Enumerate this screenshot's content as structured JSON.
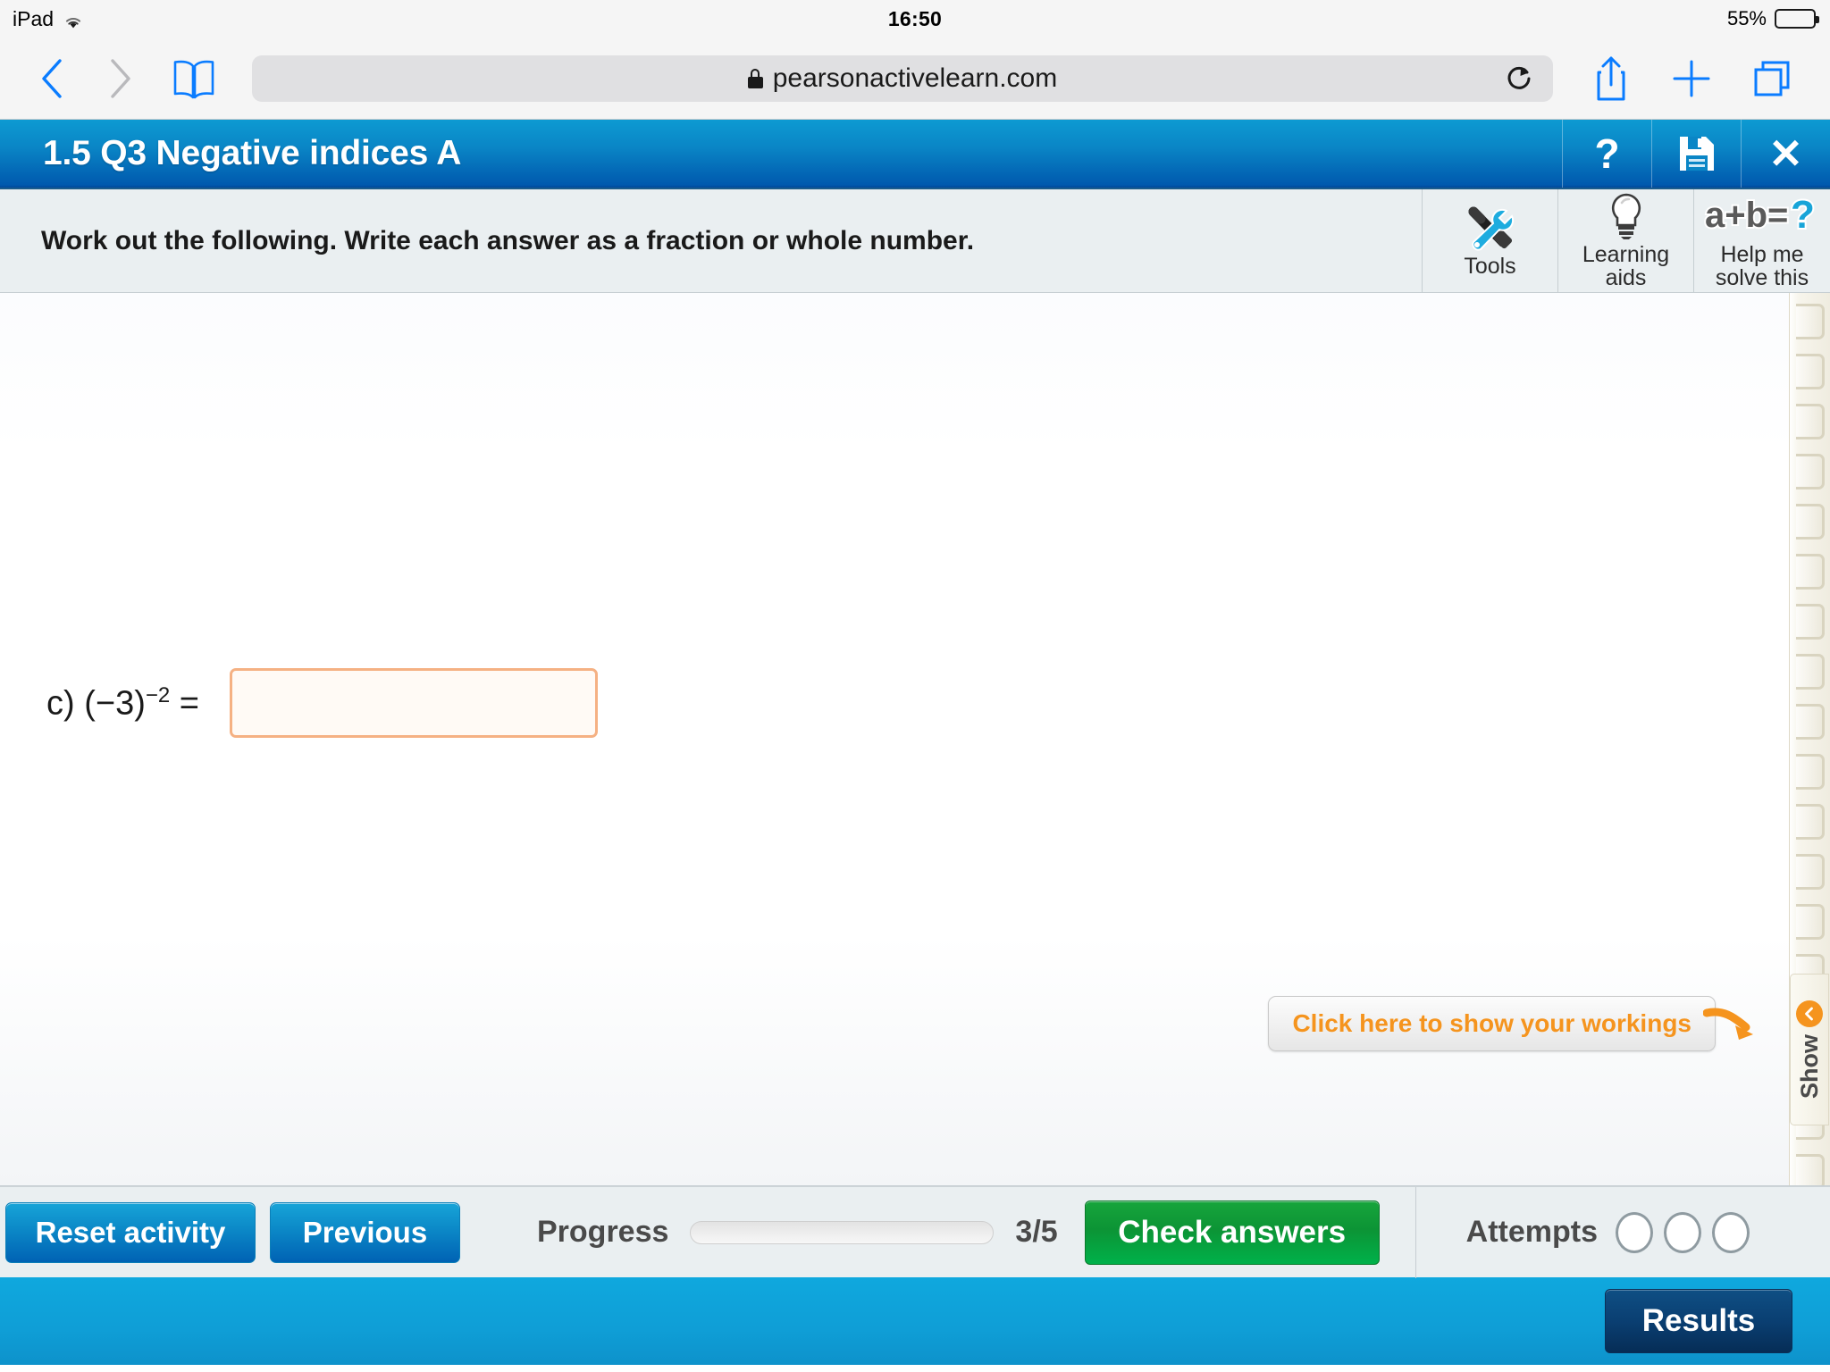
{
  "device": {
    "name": "iPad",
    "wifi_icon": "wifi-icon",
    "time": "16:50",
    "battery_percent": "55%",
    "battery_level": 55
  },
  "browser": {
    "back_icon": "chevron-left-icon",
    "forward_icon": "chevron-right-icon",
    "bookmarks_icon": "book-icon",
    "lock_icon": "lock-icon",
    "url": "pearsonactivelearn.com",
    "reload_icon": "reload-icon",
    "share_icon": "share-icon",
    "new_tab_icon": "plus-icon",
    "tabs_icon": "tabs-icon"
  },
  "header": {
    "title": "1.5 Q3 Negative indices A",
    "help_label": "?",
    "help_icon": "question-mark-icon",
    "save_icon": "floppy-disk-icon",
    "close_label": "✕",
    "close_icon": "close-icon"
  },
  "instruction": {
    "text": "Work out the following. Write each answer as a fraction or whole number.",
    "aids": [
      {
        "label": "Tools",
        "icon": "tools-icon"
      },
      {
        "label": "Learning aids",
        "line1": "Learning",
        "line2": "aids",
        "icon": "lightbulb-icon"
      },
      {
        "label": "Help me solve this",
        "line1": "Help me",
        "line2": "solve this",
        "icon": "equation-icon"
      }
    ]
  },
  "question": {
    "part": "c)",
    "expression_base": "(−3)",
    "exponent": "−2",
    "equals": "=",
    "answer_value": "",
    "answer_placeholder": ""
  },
  "workings": {
    "callout_text": "Click here to show your workings",
    "arrow_icon": "curved-arrow-icon",
    "tab_label": "Show",
    "tab_icon": "chevron-left-circle-icon"
  },
  "bottom_bar": {
    "reset_label": "Reset activity",
    "previous_label": "Previous",
    "progress_label": "Progress",
    "progress_count": "3/5",
    "progress_percent": 60,
    "check_label": "Check answers",
    "attempts_label": "Attempts",
    "attempts_total": 3,
    "attempts_used": 0
  },
  "footer": {
    "results_label": "Results"
  },
  "colors": {
    "header_blue_top": "#0d9ad2",
    "header_blue_bottom": "#0059ae",
    "accent_orange": "#f5941e",
    "check_green": "#00b14a",
    "navy": "#0a3f72",
    "instruction_bg": "#eaeff1"
  }
}
